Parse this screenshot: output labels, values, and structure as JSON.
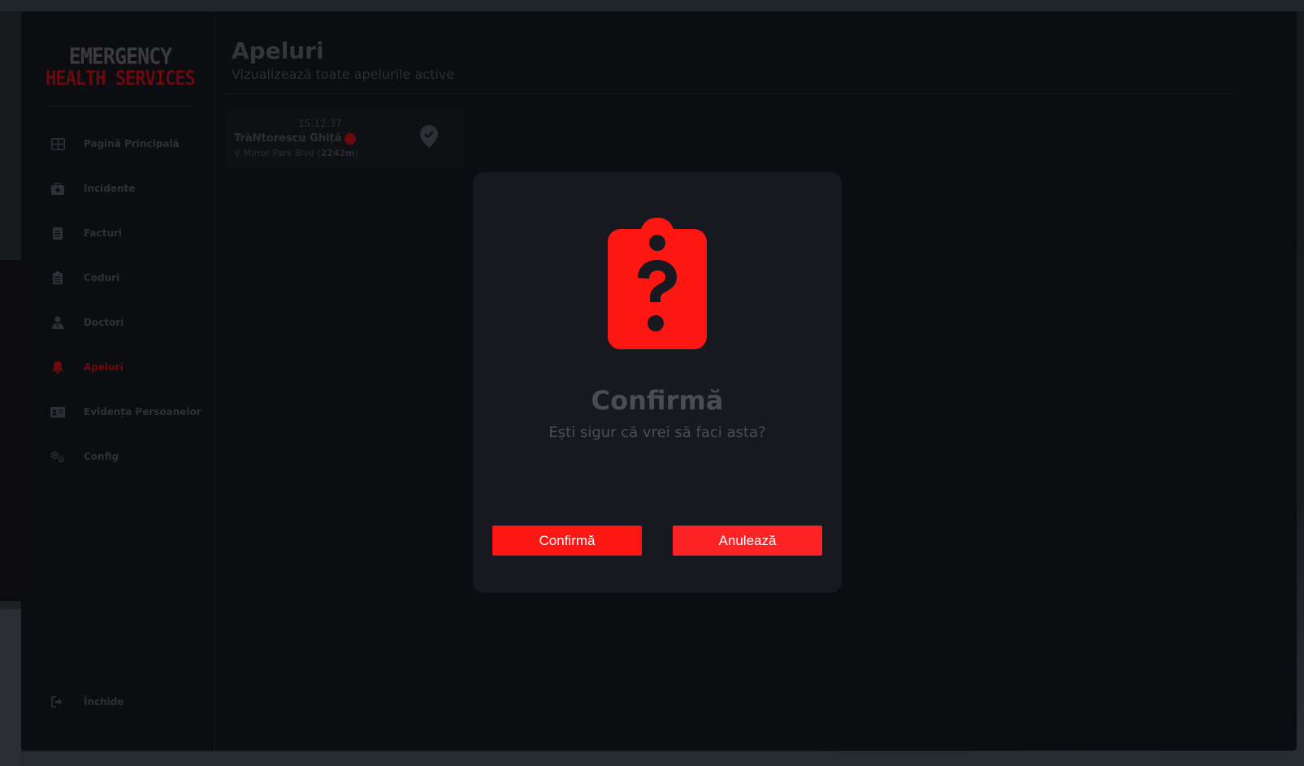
{
  "logo": {
    "line1": "EMERGENCY",
    "line2": "HEALTH SERVICES"
  },
  "sidebar": {
    "items": [
      {
        "label": "Pagină Principală",
        "icon": "dashboard-icon",
        "active": false
      },
      {
        "label": "Incidente",
        "icon": "medkit-icon",
        "active": false
      },
      {
        "label": "Facturi",
        "icon": "receipt-icon",
        "active": false
      },
      {
        "label": "Coduri",
        "icon": "clipboard-icon",
        "active": false
      },
      {
        "label": "Doctori",
        "icon": "doctor-icon",
        "active": false
      },
      {
        "label": "Apeluri",
        "icon": "bell-icon",
        "active": true
      },
      {
        "label": "Evidența Persoanelor",
        "icon": "id-card-icon",
        "active": false
      },
      {
        "label": "Config",
        "icon": "gears-icon",
        "active": false
      }
    ],
    "close": {
      "label": "Închide",
      "icon": "sign-out-icon"
    }
  },
  "header": {
    "title": "Apeluri",
    "subtitle": "Vizualizează toate apelurile active"
  },
  "calls": [
    {
      "time": "15:12:37",
      "name": "TràNtorescu Ghiță",
      "street": "Mirror Park Blvd",
      "distance": "2242m"
    }
  ],
  "modal": {
    "icon": "clipboard-question-icon",
    "title": "Confirmă",
    "message": "Ești sigur că vrei să faci asta?",
    "confirm_label": "Confirmă",
    "cancel_label": "Anulează"
  },
  "colors": {
    "accent": "#fe1613",
    "accent_dim": "#6e0a0d",
    "modal_bg": "#171820",
    "panel_bg": "#0c0d11"
  }
}
